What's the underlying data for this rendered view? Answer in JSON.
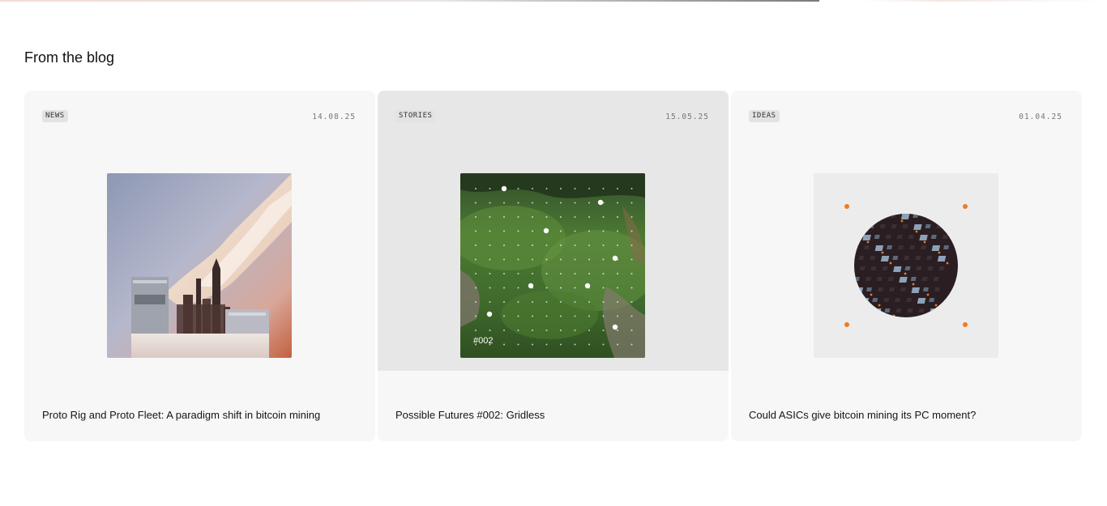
{
  "section": {
    "title": "From the blog"
  },
  "posts": [
    {
      "tag": "NEWS",
      "date": "14.08.25",
      "title": "Proto Rig and Proto Fleet: A paradigm shift in bitcoin mining",
      "image": "skyline-mining-rig-illustration"
    },
    {
      "tag": "STORIES",
      "date": "15.05.25",
      "title": "Possible Futures #002: Gridless",
      "image": "green-valley-grid-dots",
      "image_caption": "#002"
    },
    {
      "tag": "IDEAS",
      "date": "01.04.25",
      "title": "Could ASICs give bitcoin mining its PC moment?",
      "image": "circuit-circle-illustration"
    }
  ],
  "colors": {
    "card_bg": "#f7f7f7",
    "card_hover_bg": "#e7e7e7",
    "tag_bg": "#e3e3e3",
    "accent_orange": "#f07a1e"
  }
}
